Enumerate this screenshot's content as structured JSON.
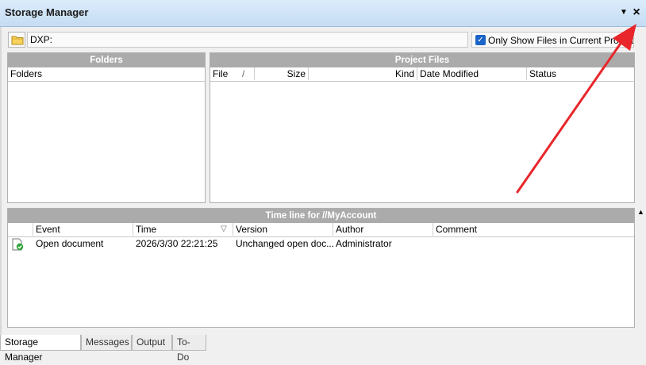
{
  "window": {
    "title": "Storage Manager",
    "menu_icon": "dropdown-triangle-icon",
    "close_icon": "close-icon"
  },
  "pathbar": {
    "path_value": "DXP:",
    "only_show_label": "Only Show Files in Current Project",
    "only_show_checked": true
  },
  "folders_panel": {
    "header": "Folders",
    "columns": [
      "Folders"
    ]
  },
  "files_panel": {
    "header": "Project Files",
    "columns": {
      "file": "File",
      "sort": "/",
      "size": "Size",
      "kind": "Kind",
      "date": "Date Modified",
      "status": "Status"
    }
  },
  "timeline_panel": {
    "header": "Time line for //MyAccount",
    "columns": {
      "event": "Event",
      "time": "Time",
      "sort": "▽",
      "version": "Version",
      "author": "Author",
      "comment": "Comment"
    },
    "rows": [
      {
        "icon": "document-check-icon",
        "event": "Open document",
        "time": "2026/3/30 22:21:25",
        "version": "Unchanged open doc...",
        "author": "Administrator",
        "comment": ""
      }
    ]
  },
  "tabs": [
    "Storage Manager",
    "Messages",
    "Output",
    "To-Do"
  ],
  "active_tab": "Storage Manager",
  "colors": {
    "title_bar": "#c4dcf3",
    "panel_header": "#ababab",
    "checkbox": "#1c64c8",
    "annotation_arrow": "#e8262b"
  }
}
